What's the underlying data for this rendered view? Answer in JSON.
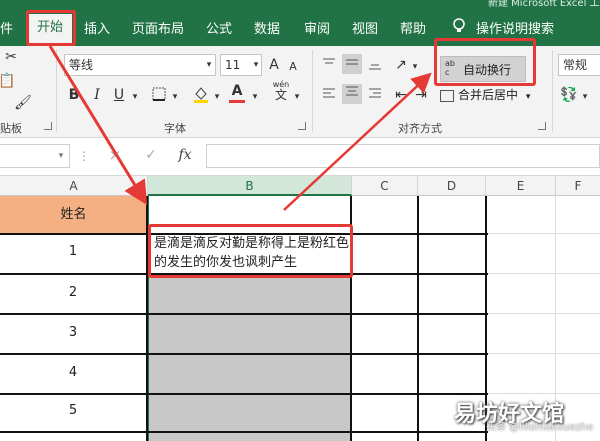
{
  "window": {
    "title": "新建 Microsoft Excel 工作表"
  },
  "menu": {
    "items": [
      "件",
      "开始",
      "插入",
      "页面布局",
      "公式",
      "数据",
      "审阅",
      "视图",
      "帮助"
    ],
    "search": "操作说明搜索"
  },
  "ribbon": {
    "clipboard_label": "贴板",
    "font_label": "字体",
    "font_name": "等线",
    "font_size": "11",
    "grow_label": "A",
    "shrink_label": "A",
    "bold_label": "B",
    "italic_label": "I",
    "underline_label": "U",
    "font_color_label": "A",
    "wen_label": "wén",
    "wen_sub": "文",
    "align_label": "对齐方式",
    "wrap_text": "自动换行",
    "wrap_icon": "ab c",
    "merge_center": "合并后居中",
    "number_format": "常规"
  },
  "formula_bar": {
    "fx": "fx",
    "cancel": "×",
    "confirm": "✓",
    "value": ""
  },
  "grid": {
    "columns": [
      "A",
      "B",
      "C",
      "D",
      "E",
      "F"
    ],
    "header_cell": "姓名",
    "row_numbers": [
      "1",
      "2",
      "3",
      "4",
      "5"
    ],
    "wrapped_text": "是滴是滴反对勤是称得上是粉红色的发生的你发也讽刺产生"
  },
  "watermark": {
    "main": "易坊好文馆",
    "sub": "头条 @lilishuaixuezhe"
  },
  "colors": {
    "excel_green": "#217346",
    "highlight_red": "#e53935",
    "header_orange": "#f4b083",
    "selection_gray": "#c8c8c8"
  }
}
